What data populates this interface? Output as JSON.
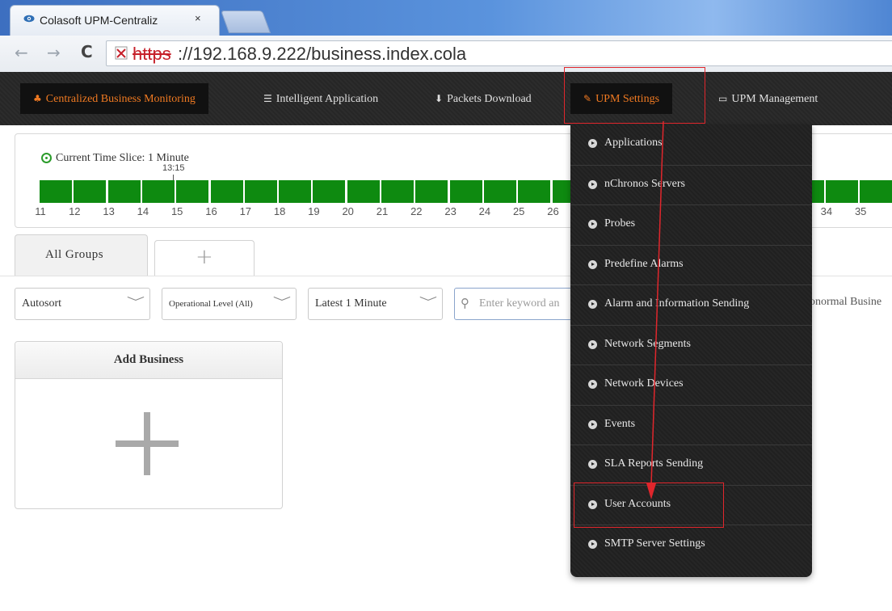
{
  "browser": {
    "tab_title": "Colasoft UPM-Centraliz",
    "tab_close": "×",
    "url_scheme": "https",
    "url_rest": "://192.168.9.222/business.index.cola",
    "back_icon": "←",
    "forward_icon": "→",
    "reload_icon": "C"
  },
  "nav": {
    "items": [
      {
        "label": "Centralized Business Monitoring",
        "icon": "sitemap-icon",
        "glyph": "♣"
      },
      {
        "label": "Intelligent Application",
        "icon": "list-icon",
        "glyph": "☰"
      },
      {
        "label": "Packets Download",
        "icon": "download-icon",
        "glyph": "⬇"
      },
      {
        "label": "UPM Settings",
        "icon": "wrench-icon",
        "glyph": "✎"
      },
      {
        "label": "UPM Management",
        "icon": "laptop-icon",
        "glyph": "▭"
      }
    ]
  },
  "timeline": {
    "label": "Current Time Slice: 1 Minute",
    "current_time": "13:15",
    "ticks": [
      "11",
      "12",
      "13",
      "14",
      "15",
      "16",
      "17",
      "18",
      "19",
      "20",
      "21",
      "22",
      "23",
      "24",
      "25",
      "26",
      "34",
      "35"
    ]
  },
  "groups": {
    "tabs": [
      {
        "label": "All Groups"
      },
      {
        "label": "+"
      }
    ]
  },
  "filters": {
    "sort": "Autosort",
    "level": "Operational Level (All)",
    "time": "Latest 1 Minute",
    "search_placeholder": "Enter keyword an",
    "abnormal": "onormal Busine",
    "chevron": "﹀",
    "search_glyph": "⚲"
  },
  "card": {
    "title": "Add Business"
  },
  "settings_menu": {
    "items": [
      {
        "label": "Applications"
      },
      {
        "label": "nChronos Servers"
      },
      {
        "label": "Probes"
      },
      {
        "label": "Predefine Alarms"
      },
      {
        "label": "Alarm and Information Sending"
      },
      {
        "label": "Network Segments"
      },
      {
        "label": "Network Devices"
      },
      {
        "label": "Events"
      },
      {
        "label": "SLA Reports Sending"
      },
      {
        "label": "User Accounts"
      },
      {
        "label": "SMTP Server Settings"
      }
    ]
  },
  "colors": {
    "accent": "#f07a22",
    "bar_green": "#0e8a10",
    "annotation_red": "#e0262c"
  }
}
